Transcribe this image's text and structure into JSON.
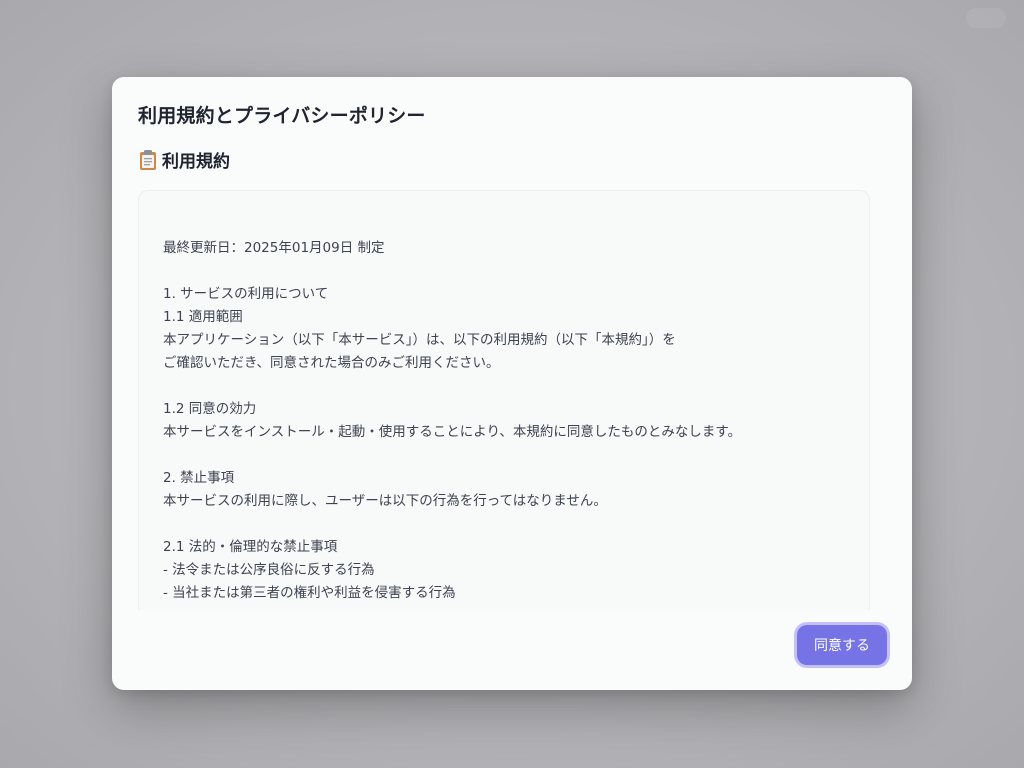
{
  "modal": {
    "title": "利用規約とプライバシーポリシー",
    "section_icon": "clipboard-icon",
    "section_title": "利用規約",
    "terms_text": "最終更新日：2025年01月09日 制定\n\n1. サービスの利用について\n1.1 適用範囲\n本アプリケーション（以下「本サービス」）は、以下の利用規約（以下「本規約」）を\nご確認いただき、同意された場合のみご利用ください。\n\n1.2 同意の効力\n本サービスをインストール・起動・使用することにより、本規約に同意したものとみなします。\n\n2. 禁止事項\n本サービスの利用に際し、ユーザーは以下の行為を行ってはなりません。\n\n2.1 法的・倫理的な禁止事項\n- 法令または公序良俗に反する行為\n- 当社または第三者の権利や利益を侵害する行為",
    "agree_label": "同意する"
  },
  "colors": {
    "accent": "#7673e7",
    "backdrop": "#b8b8bc",
    "modal_bg": "#fafbfb",
    "title_text": "#1f2430",
    "body_text": "#3d4350"
  }
}
